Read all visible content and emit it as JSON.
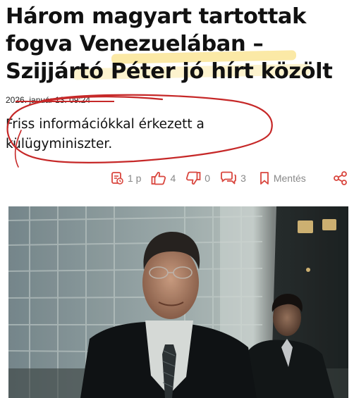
{
  "article": {
    "headline_lines": [
      "Három magyart tartottak",
      "fogva Venezuelában –",
      "Szijjártó Péter jó hírt közölt"
    ],
    "date": "2026. január 13. 09:24",
    "lead_lines": [
      "Friss információkkal érkezett a",
      "külügyminiszter."
    ]
  },
  "actions": {
    "read_time": "1 p",
    "likes": "4",
    "dislikes": "0",
    "comments": "3",
    "save_label": "Mentés"
  },
  "colors": {
    "accent": "#d9463e",
    "highlight": "#fbe9a6",
    "annotation": "#c62828",
    "muted_text": "#888888"
  },
  "icons": [
    "read-time-icon",
    "thumbs-up-icon",
    "thumbs-down-icon",
    "comment-icon",
    "bookmark-icon",
    "share-icon"
  ]
}
